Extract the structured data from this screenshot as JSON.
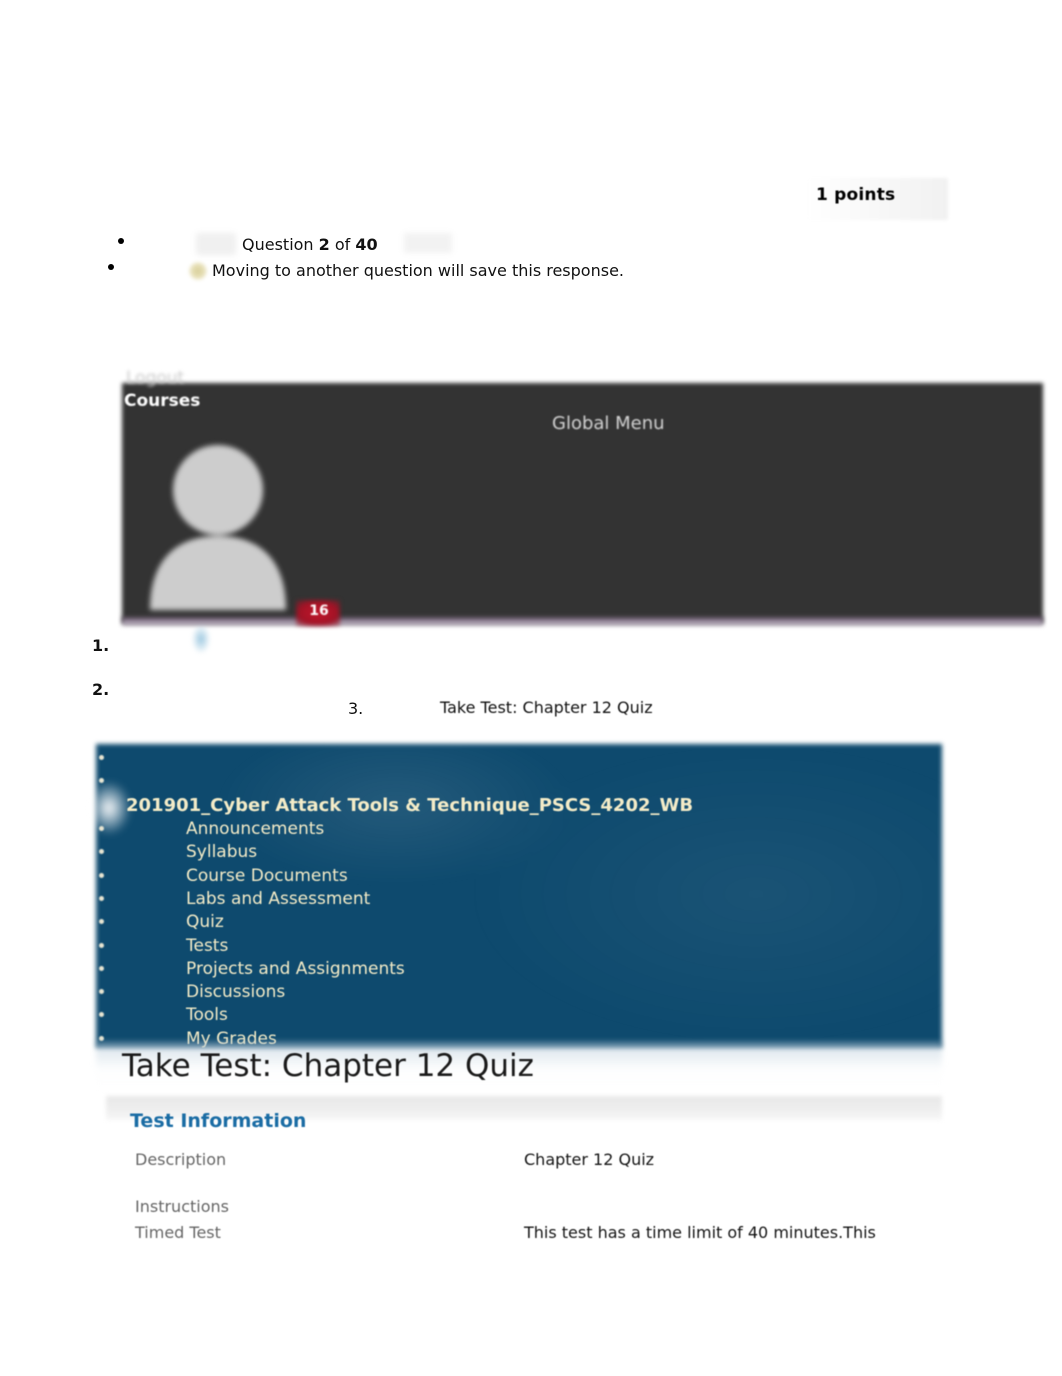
{
  "question_header": {
    "points_label": "1 points",
    "question_prefix": "Question ",
    "question_number": "2",
    "question_of": " of ",
    "question_total": "40",
    "save_note": "Moving to another question will save this response.",
    "save_indicator_icon": "save-dot-icon"
  },
  "global_bar": {
    "logout_label": "Logout",
    "courses_label": "Courses",
    "global_menu_label": "Global Menu",
    "avatar_icon": "user-avatar-icon",
    "notification_count": "16",
    "bar_color": "#333333"
  },
  "breadcrumb": {
    "item1_marker": "1.",
    "item2_marker": "2.",
    "item3_marker": "3.",
    "item3_label": "Take Test: Chapter 12 Quiz"
  },
  "course_menu": {
    "panel_color": "#0e4a6e",
    "text_color": "#f4ecc8",
    "title": "201901_Cyber Attack Tools & Technique_PSCS_4202_WB",
    "items": [
      {
        "label": "Announcements"
      },
      {
        "label": "Syllabus"
      },
      {
        "label": "Course Documents"
      },
      {
        "label": "Labs and Assessment"
      },
      {
        "label": "Quiz"
      },
      {
        "label": "Tests"
      },
      {
        "label": "Projects and Assignments"
      },
      {
        "label": "Discussions"
      },
      {
        "label": "Tools"
      },
      {
        "label": "My Grades"
      }
    ]
  },
  "content": {
    "page_title": "Take Test: Chapter 12 Quiz",
    "section_heading": "Test Information",
    "section_heading_color": "#1a6ca4",
    "rows": [
      {
        "label": "Description",
        "value": "Chapter 12 Quiz"
      },
      {
        "label": "Instructions",
        "value": ""
      },
      {
        "label": "Timed Test",
        "value": "This test has a time limit of 40 minutes.This"
      }
    ]
  }
}
